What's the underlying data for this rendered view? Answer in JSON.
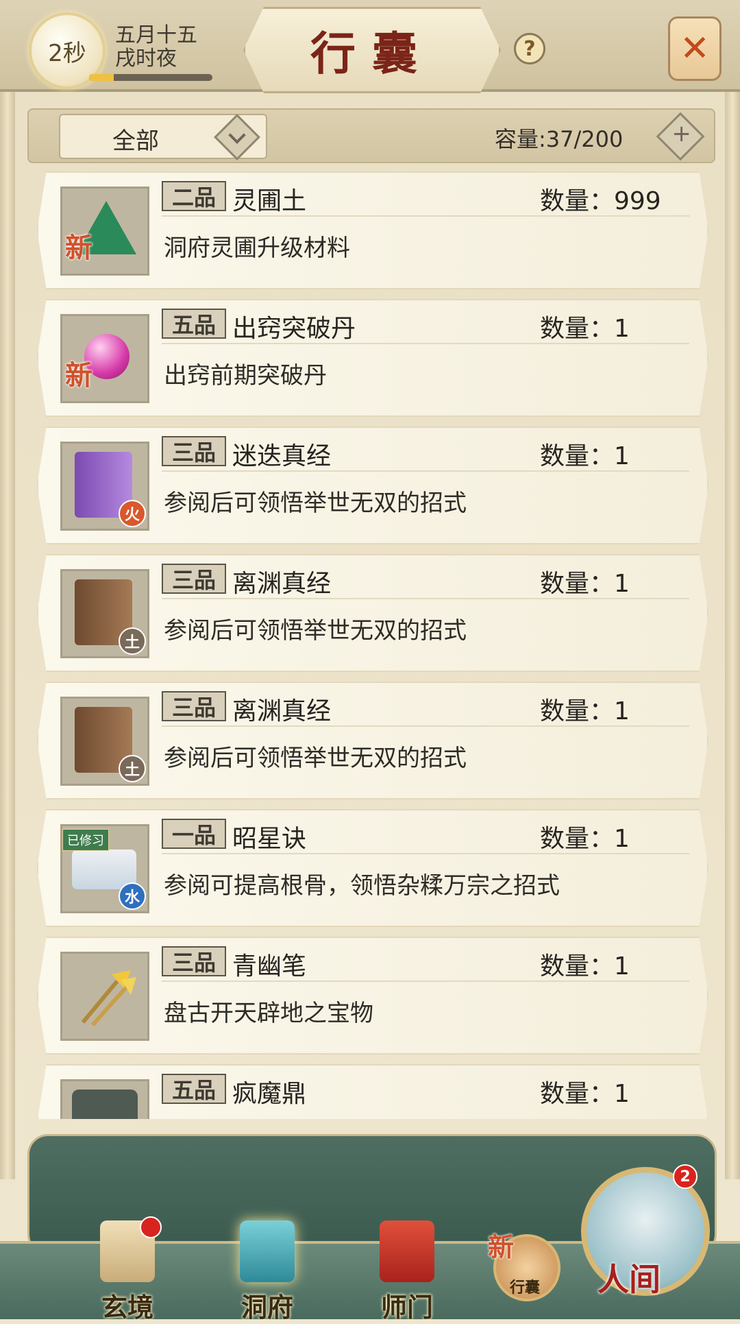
{
  "header": {
    "timer": "2秒",
    "date_line1": "五月十五",
    "date_line2": "戌时夜",
    "progress": 0.2,
    "title": "行囊",
    "help": "?",
    "close": "✕"
  },
  "filter": {
    "selected": "全部",
    "capacity": "容量:37/200"
  },
  "items": [
    {
      "grade": "二品",
      "name": "灵圃土",
      "qty": "数量：999",
      "desc": "洞府灵圃升级材料",
      "tag": "新"
    },
    {
      "grade": "五品",
      "name": "出窍突破丹",
      "qty": "数量：1",
      "desc": "出窍前期突破丹",
      "tag": "新"
    },
    {
      "grade": "三品",
      "name": "迷迭真经",
      "qty": "数量：1",
      "desc": "参阅后可领悟举世无双的招式",
      "element": "火"
    },
    {
      "grade": "三品",
      "name": "离渊真经",
      "qty": "数量：1",
      "desc": "参阅后可领悟举世无双的招式",
      "element": "土"
    },
    {
      "grade": "三品",
      "name": "离渊真经",
      "qty": "数量：1",
      "desc": "参阅后可领悟举世无双的招式",
      "element": "土"
    },
    {
      "grade": "一品",
      "name": "昭星诀",
      "qty": "数量：1",
      "desc": "参阅可提高根骨，领悟杂糅万宗之招式",
      "element": "水",
      "status": "已修习"
    },
    {
      "grade": "三品",
      "name": "青幽笔",
      "qty": "数量：1",
      "desc": "盘古开天辟地之宝物"
    },
    {
      "grade": "五品",
      "name": "疯魔鼎",
      "qty": "数量：1",
      "desc": ""
    }
  ],
  "nav": {
    "xuanjing": "玄境",
    "dongfu": "洞府",
    "shimen": "师门",
    "bag_new": "新",
    "bag": "行囊",
    "renjian": "人间",
    "renjian_badge": "2"
  }
}
